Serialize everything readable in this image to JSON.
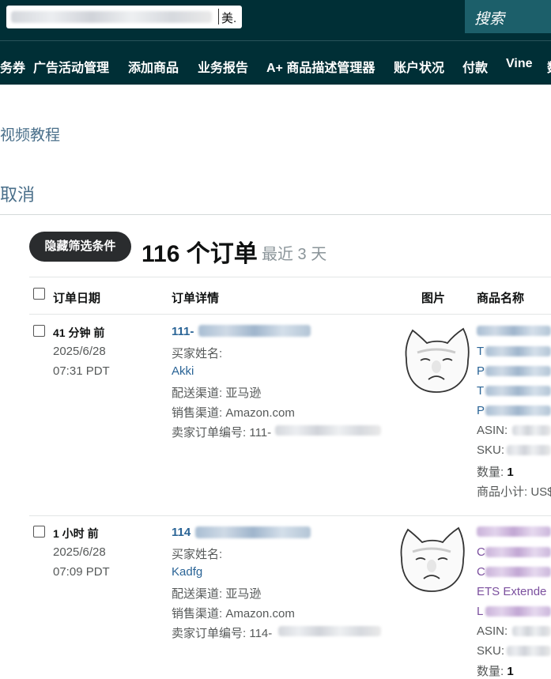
{
  "header": {
    "store_suffix": "美.",
    "search_label": "搜索"
  },
  "nav": {
    "items": [
      "服务券",
      "广告活动管理",
      "添加商品",
      "业务报告",
      "A+ 商品描述管理器",
      "账户状况",
      "付款",
      "Vine",
      "数"
    ]
  },
  "page": {
    "video_tutorial": "视频教程",
    "cancel": "取消"
  },
  "summary": {
    "filter_button": "隐藏筛选条件",
    "order_count": "116 个订单",
    "range": "最近 3 天"
  },
  "table": {
    "headers": [
      "订单日期",
      "订单详情",
      "图片",
      "商品名称"
    ],
    "rows": [
      {
        "age": "41 分钟 前",
        "date": "2025/6/28",
        "time": "07:31 PDT",
        "order_id_prefix": "111-",
        "buyer_label": "买家姓名:",
        "buyer_name": "Akki",
        "shipping": "配送渠道: 亚马逊",
        "sales_channel": "销售渠道: Amazon.com",
        "seller_order_label": "卖家订单编号: 111-",
        "product_title_lines": [
          "T",
          "P",
          "T",
          "P"
        ],
        "asin_label": "ASIN:",
        "sku_label": "SKU:",
        "qty_label": "数量:",
        "qty_value": "1",
        "subtotal_label": "商品小计: US$"
      },
      {
        "age": "1 小时 前",
        "date": "2025/6/28",
        "time": "07:09 PDT",
        "order_id_prefix": "114",
        "buyer_label": "买家姓名:",
        "buyer_name": "Kadfg",
        "shipping": "配送渠道: 亚马逊",
        "sales_channel": "销售渠道: Amazon.com",
        "seller_order_label": "卖家订单编号: 114-",
        "product_title_lines": [
          "",
          "C",
          "C",
          "ETS  Extende",
          "L"
        ],
        "asin_label": "ASIN:",
        "sku_label": "SKU:",
        "qty_label": "数量:",
        "qty_value": "1"
      }
    ]
  }
}
